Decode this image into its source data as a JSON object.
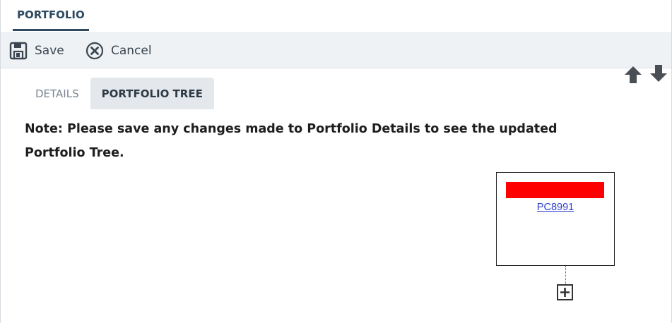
{
  "header": {
    "title": "PORTFOLIO"
  },
  "toolbar": {
    "save_label": "Save",
    "cancel_label": "Cancel",
    "save_icon": "floppy-disk-icon",
    "cancel_icon": "circle-x-icon",
    "move_up_icon": "arrow-up-icon",
    "move_down_icon": "arrow-down-icon"
  },
  "tabs": [
    {
      "label": "DETAILS",
      "active": false
    },
    {
      "label": "PORTFOLIO TREE",
      "active": true
    }
  ],
  "note": "Note: Please save any changes made to Portfolio Details to see the updated Portfolio Tree.",
  "tree": {
    "node": {
      "link_text": "PC8991",
      "redacted_color": "#ff0000"
    },
    "expand_icon": "plus-square-icon"
  },
  "colors": {
    "accent": "#2f4a61",
    "toolbar_bg": "#eef2f5",
    "link": "#2c3fcf"
  }
}
